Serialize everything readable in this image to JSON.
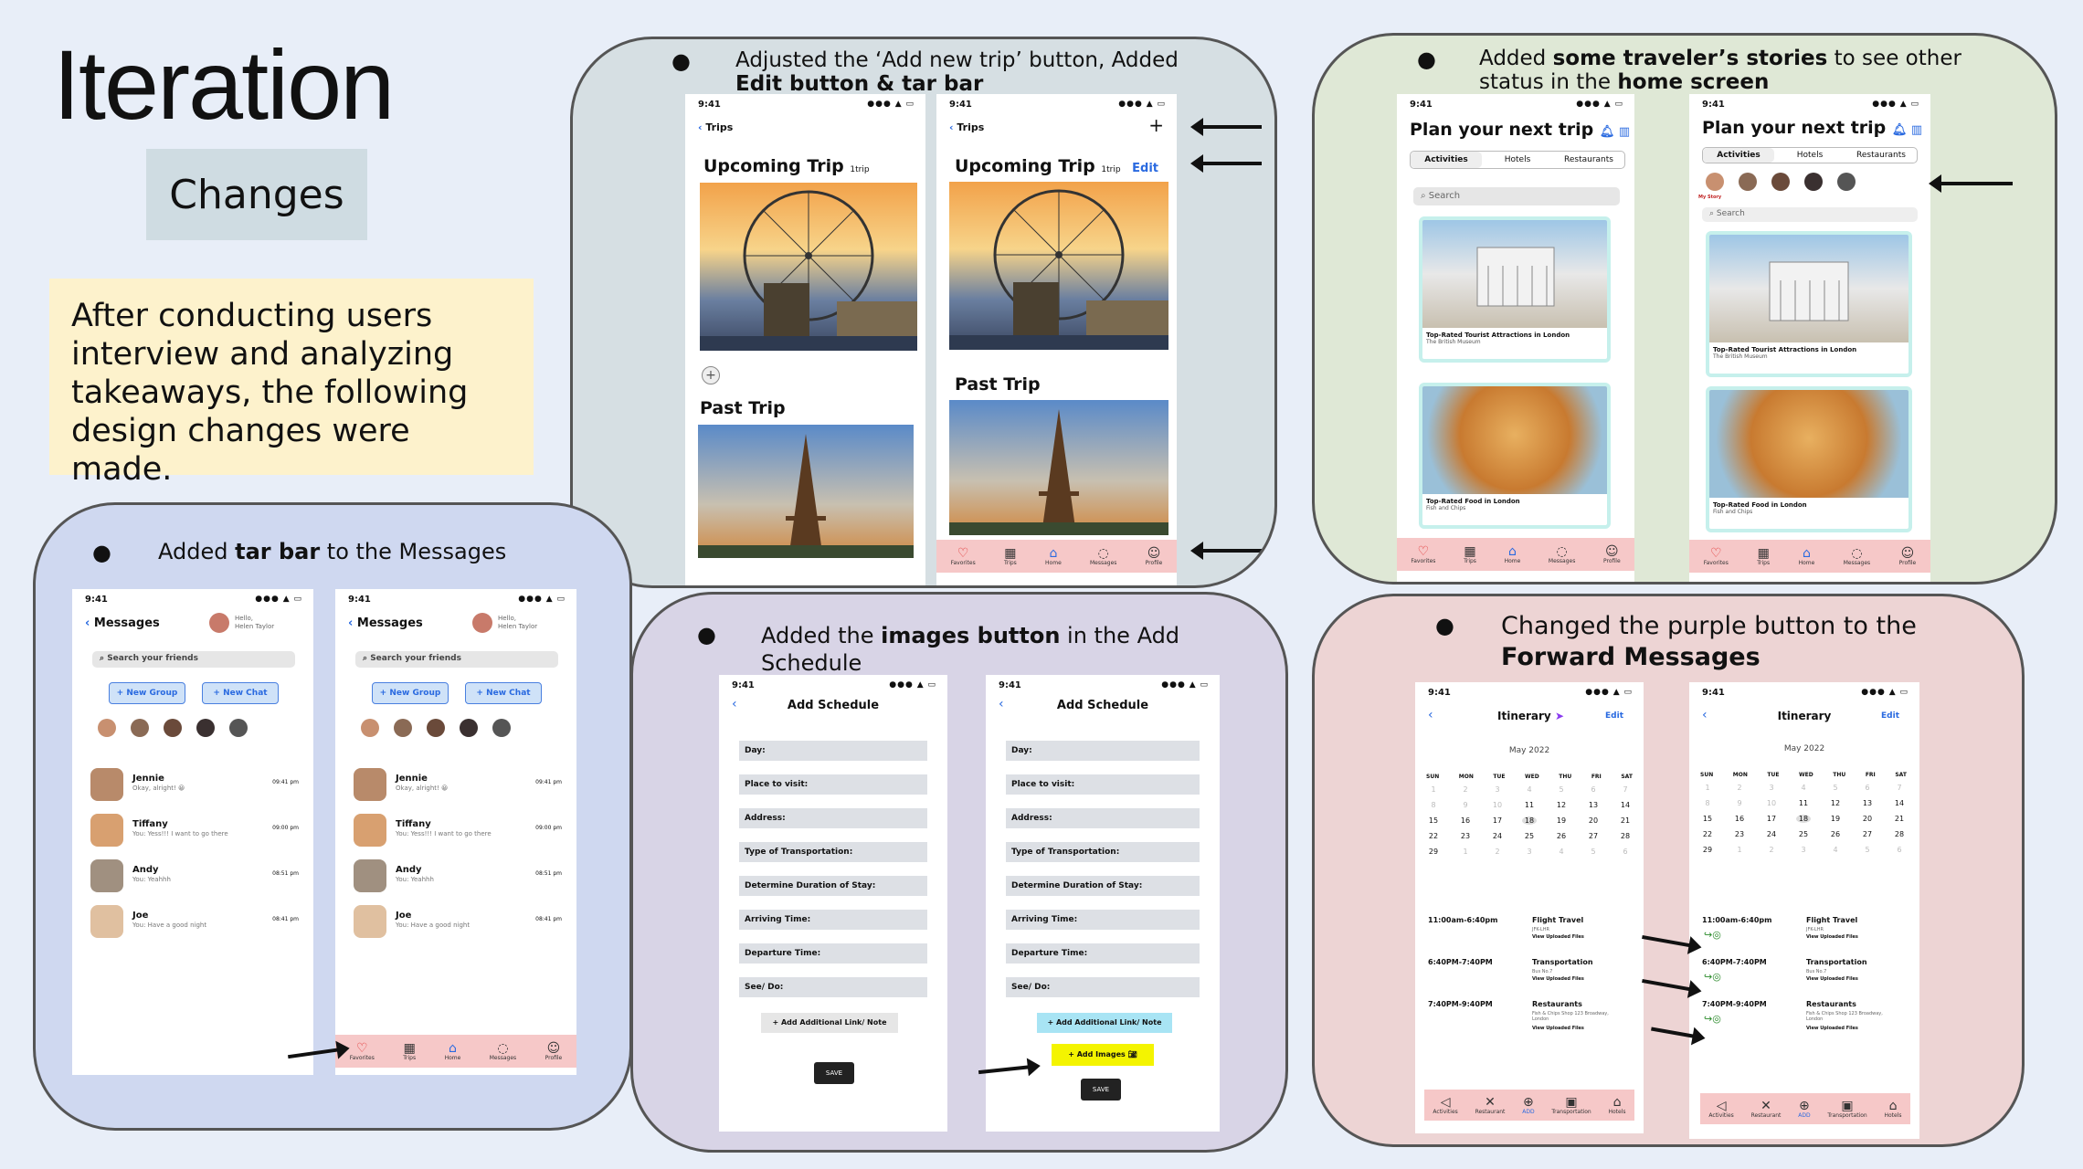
{
  "page": {
    "title": "Iteration",
    "changes_label": "Changes",
    "description": "After conducting users interview and analyzing takeaways, the following design changes were made."
  },
  "panels": {
    "trips": {
      "caption_1": "Adjusted the ‘Add new trip’ button, Added ",
      "caption_b1": "Edit button & tar bar"
    },
    "home": {
      "caption_1": "Added ",
      "caption_b1": "some traveler’s stories",
      "caption_2": " to see other status in the ",
      "caption_b2": "home screen"
    },
    "messages": {
      "caption_1": "Added ",
      "caption_b1": "tar bar",
      "caption_2": " to the Messages"
    },
    "schedule": {
      "caption_1": "Added the ",
      "caption_b1": "images button",
      "caption_2": " in the Add Schedule"
    },
    "itinerary": {
      "caption_1": "Changed the purple button to the ",
      "caption_b1": "Forward Messages"
    }
  },
  "phone": {
    "time": "9:41",
    "signal": "●●● ▲ ▭"
  },
  "trips": {
    "back": "Trips",
    "upcoming": "Upcoming Trip",
    "count": "1trip",
    "past": "Past Trip",
    "edit": "Edit",
    "add": "+"
  },
  "home": {
    "title": "Plan your next trip",
    "tabs": [
      "Activities",
      "Hotels",
      "Restaurants"
    ],
    "search": "Search",
    "card1": "Top-Rated Tourist Attractions in London",
    "card1_sub": "The British Museum",
    "card2": "Top-Rated Food in London",
    "card2_sub": "Fish and Chips",
    "my_story": "My Story"
  },
  "messages": {
    "title": "Messages",
    "hello": "Hello,",
    "user": "Helen Taylor",
    "search": "Search your friends",
    "new_group": "New Group",
    "new_chat": "New Chat",
    "rows": [
      {
        "name": "Jennie",
        "msg": "Okay, alright! 😀",
        "time": "09:41 pm"
      },
      {
        "name": "Tiffany",
        "msg": "You: Yess!!! I want to go there",
        "time": "09:00 pm"
      },
      {
        "name": "Andy",
        "msg": "You: Yeahhh",
        "time": "08:51 pm"
      },
      {
        "name": "Joe",
        "msg": "You: Have a good night",
        "time": "08:41 pm"
      }
    ]
  },
  "tabbar": {
    "items": [
      "Favorites",
      "Trips",
      "Home",
      "Messages",
      "Profile"
    ]
  },
  "schedule": {
    "title": "Add Schedule",
    "fields": [
      "Day:",
      "Place to visit:",
      "Address:",
      "Type of Transportation:",
      "Determine Duration of Stay:",
      "Arriving Time:",
      "Departure Time:",
      "See/ Do:"
    ],
    "link": "Add Additional Link/ Note",
    "images": "Add Images",
    "save": "SAVE"
  },
  "itinerary": {
    "title": "Itinerary",
    "edit": "Edit",
    "month": "May 2022",
    "days": [
      "SUN",
      "MON",
      "TUE",
      "WED",
      "THU",
      "FRI",
      "SAT"
    ],
    "weeks": [
      [
        "1",
        "2",
        "3",
        "4",
        "5",
        "6",
        "7"
      ],
      [
        "8",
        "9",
        "10",
        "11",
        "12",
        "13",
        "14"
      ],
      [
        "15",
        "16",
        "17",
        "18",
        "19",
        "20",
        "21"
      ],
      [
        "22",
        "23",
        "24",
        "25",
        "26",
        "27",
        "28"
      ],
      [
        "29",
        "1",
        "2",
        "3",
        "4",
        "5",
        "6"
      ]
    ],
    "events": [
      {
        "time": "11:00am-6:40pm",
        "name": "Flight Travel",
        "sub": "JFK-LHR",
        "files": "View Uploaded Files"
      },
      {
        "time": "6:40PM-7:40PM",
        "name": "Transportation",
        "sub": "Bus No.7",
        "files": "View Uploaded Files"
      },
      {
        "time": "7:40PM-9:40PM",
        "name": "Restaurants",
        "sub": "Fish & Chips Shop 123 Broadway, London",
        "files": "View Uploaded Files"
      }
    ],
    "bottom": [
      "Activities",
      "Restaurant",
      "ADD",
      "Transportation",
      "Hotels"
    ]
  },
  "colors": {
    "bg": "#e8eef8",
    "trips_panel": "#d6dfe3",
    "home_panel": "#dfe8d6",
    "msg_panel": "#cfd8f0",
    "sched_panel": "#d8d4e6",
    "itin_panel": "#edd4d4",
    "tabbar": "#f6c8c8"
  }
}
